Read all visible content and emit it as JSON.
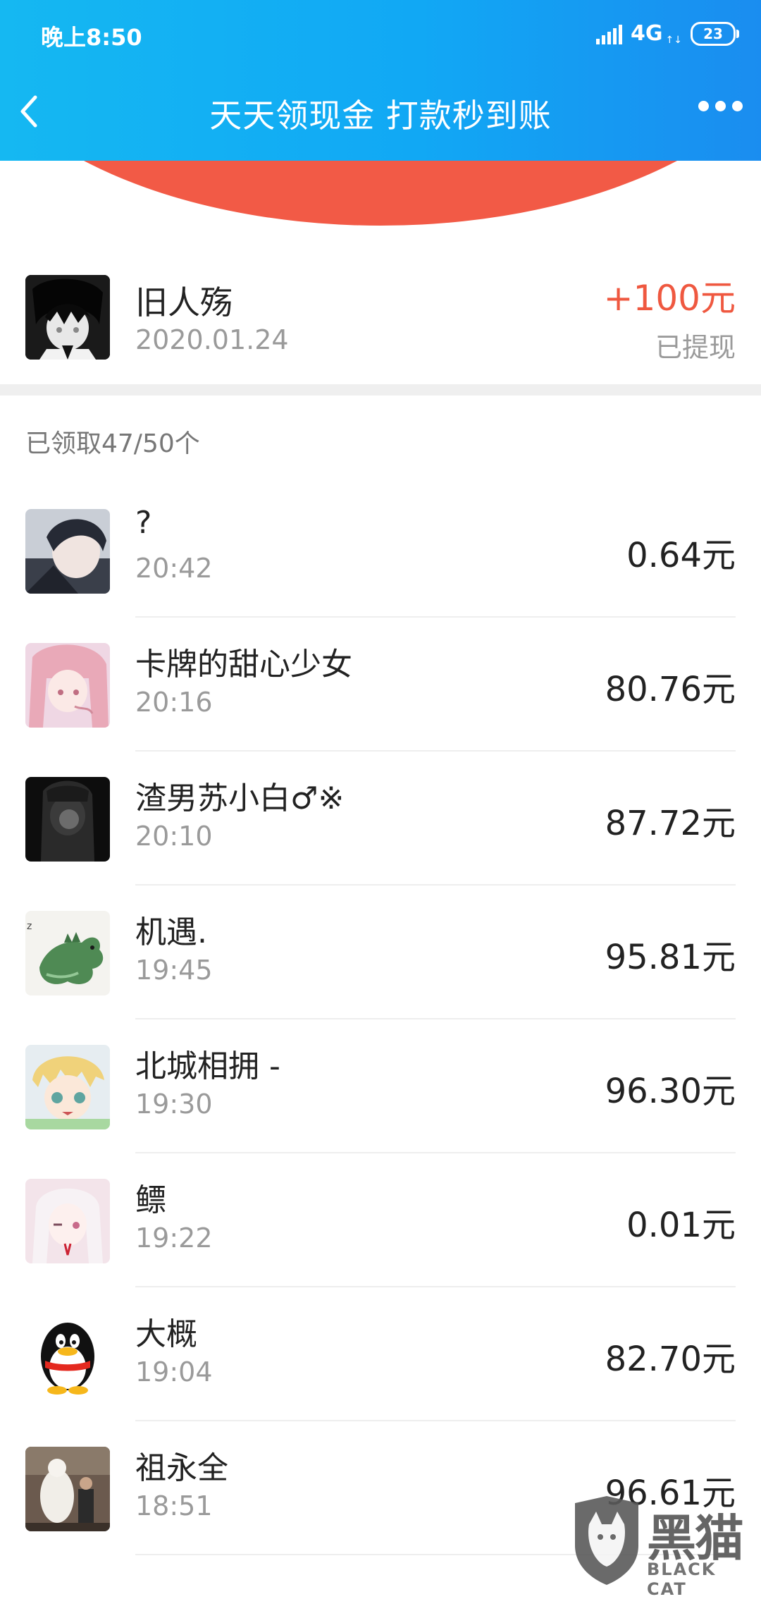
{
  "status_bar": {
    "time": "晚上8:50",
    "network": "4G",
    "battery": "23"
  },
  "header": {
    "title": "天天领现金 打款秒到账"
  },
  "colors": {
    "header_blue": "#11a8f4",
    "arc_red": "#f25a46",
    "amount_red": "#ef5840"
  },
  "owner": {
    "name": "旧人殇",
    "date": "2020.01.24",
    "amount": "+100元",
    "status": "已提现"
  },
  "claimed_count": "已领取47/50个",
  "records": [
    {
      "name": "?",
      "time": "20:42",
      "amount": "0.64元",
      "avatar": "anime-boy-avatar"
    },
    {
      "name": "卡牌的甜心少女",
      "time": "20:16",
      "amount": "80.76元",
      "avatar": "anime-girl-pink-avatar"
    },
    {
      "name": "渣男苏小白♂※",
      "time": "20:10",
      "amount": "87.72元",
      "avatar": "dark-hooded-avatar"
    },
    {
      "name": "机遇.",
      "time": "19:45",
      "amount": "95.81元",
      "avatar": "green-dinosaur-avatar"
    },
    {
      "name": "北城相拥 -",
      "time": "19:30",
      "amount": "96.30元",
      "avatar": "anime-blonde-boy-avatar"
    },
    {
      "name": "鳔",
      "time": "19:22",
      "amount": "0.01元",
      "avatar": "anime-white-hair-girl-avatar"
    },
    {
      "name": "大概",
      "time": "19:04",
      "amount": "82.70元",
      "avatar": "qq-penguin-avatar"
    },
    {
      "name": "祖永全",
      "time": "18:51",
      "amount": "96.61元",
      "avatar": "polar-bear-photo-avatar"
    }
  ],
  "watermark": {
    "main": "黑猫",
    "sub": "BLACK CAT"
  }
}
